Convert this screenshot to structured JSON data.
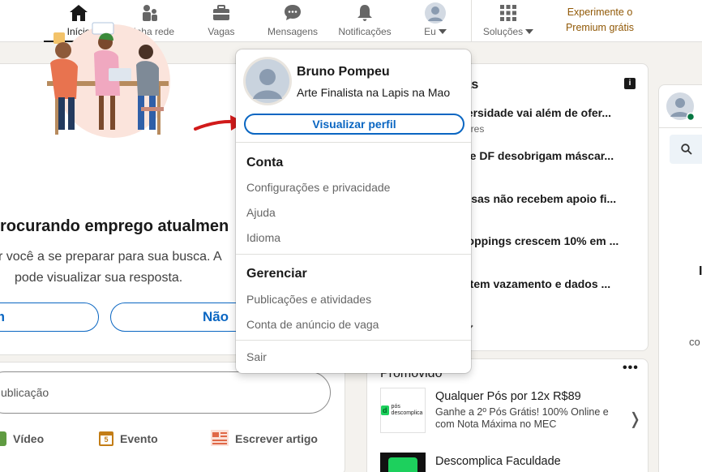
{
  "nav": {
    "items": [
      {
        "label": "Início",
        "icon": "home-icon",
        "active": true
      },
      {
        "label": "Minha rede",
        "icon": "network-icon"
      },
      {
        "label": "Vagas",
        "icon": "briefcase-icon"
      },
      {
        "label": "Mensagens",
        "icon": "message-icon"
      },
      {
        "label": "Notificações",
        "icon": "bell-icon"
      },
      {
        "label": "Eu",
        "icon": "avatar"
      },
      {
        "label": "Soluções",
        "icon": "grid-icon"
      }
    ],
    "premium_line1": "Experimente o",
    "premium_line2": "Premium grátis"
  },
  "left_card": {
    "heading": "rocurando emprego atualmen",
    "text_line1": "r você a se preparar para sua busca. A",
    "text_line2": "pode visualizar sua resposta.",
    "button_yes": "m",
    "button_no": "Não"
  },
  "post_box": {
    "placeholder": "ublicação",
    "actions": [
      {
        "label": "Vídeo",
        "icon": "video-icon",
        "color": "#5f9b41"
      },
      {
        "label": "Evento",
        "icon": "calendar-icon",
        "color": "#c37d16"
      },
      {
        "label": "Escrever artigo",
        "icon": "article-icon",
        "color": "#e06847"
      }
    ]
  },
  "news": {
    "title": "ias",
    "items": [
      "versidade vai além de ofer...",
      "s e DF desobrigam máscar...",
      "resas não recebem apoio fi...",
      "hoppings crescem 10% em ...",
      "e tem vazamento e dados ..."
    ],
    "sub": "itores"
  },
  "promo": {
    "title": "Promovido",
    "ad1_logo_text": "pós descomplica",
    "ad1_head": "Qualquer Pós por 12x R$89",
    "ad1_desc": "Ganhe a 2º Pós Grátis! 100% Online e com Nota Máxima no MEC",
    "ad2_head": "Descomplica Faculdade"
  },
  "right_card": {
    "letter_1": "I",
    "letter_2": "co"
  },
  "dropdown": {
    "name": "Bruno Pompeu",
    "headline": "Arte Finalista na Lapis na Mao",
    "view_profile": "Visualizar perfil",
    "section_account": "Conta",
    "account_links": [
      "Configurações e privacidade",
      "Ajuda",
      "Idioma"
    ],
    "section_manage": "Gerenciar",
    "manage_links": [
      "Publicações e atividades",
      "Conta de anúncio de vaga"
    ],
    "signout": "Sair"
  },
  "colors": {
    "accent": "#0a66c2",
    "premium": "#915907",
    "annotation_arrow": "#d11a1a"
  }
}
